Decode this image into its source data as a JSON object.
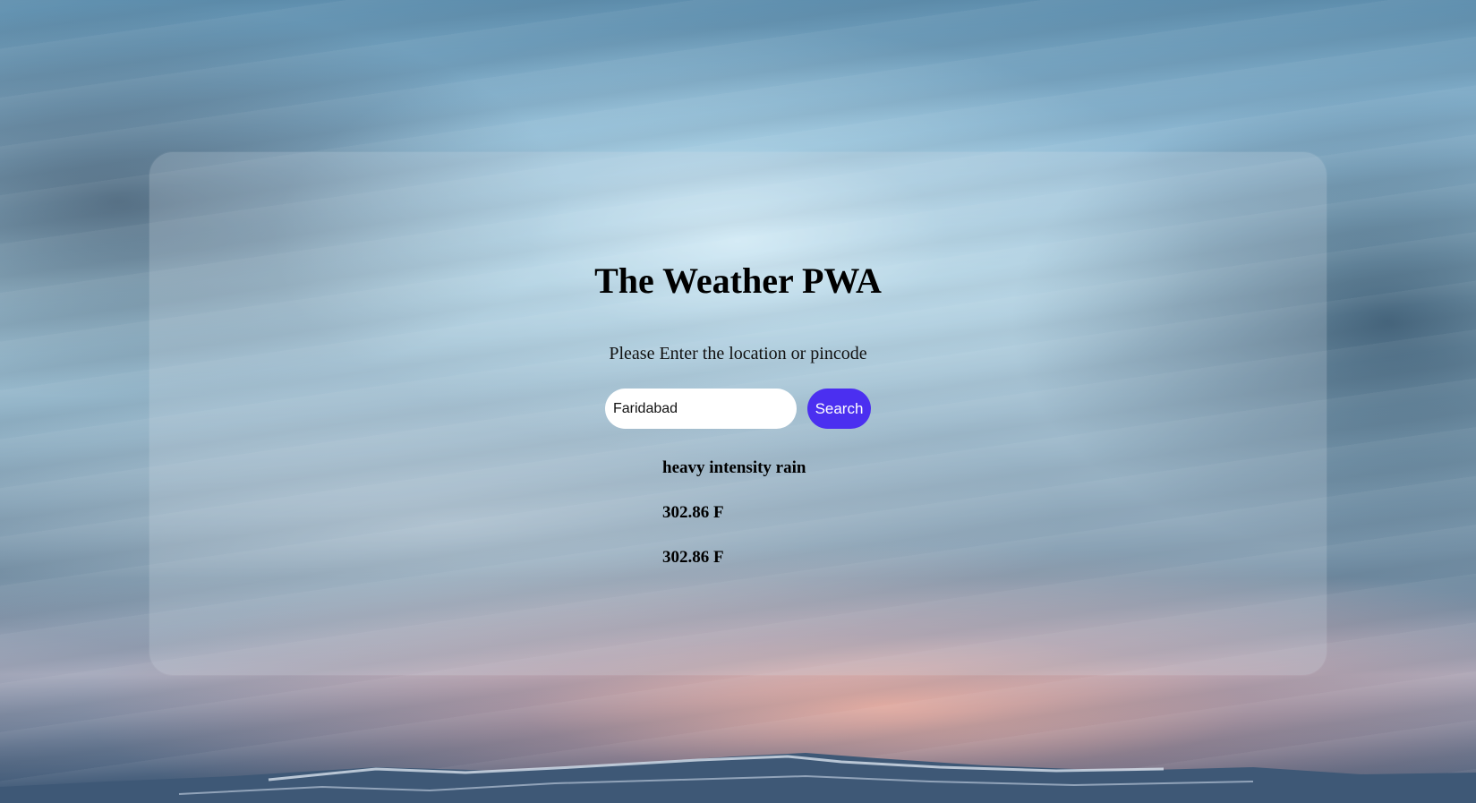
{
  "app": {
    "title": "The Weather PWA",
    "prompt": "Please Enter the location or pincode"
  },
  "search": {
    "value": "Faridabad",
    "button_label": "Search"
  },
  "results": {
    "description": "heavy intensity rain",
    "temperature": "302.86 F",
    "feels_like": "302.86 F"
  },
  "colors": {
    "button": "#4b2ff0",
    "input_bg": "#ffffff",
    "panel_overlay": "rgba(215,225,232,0.22)"
  }
}
